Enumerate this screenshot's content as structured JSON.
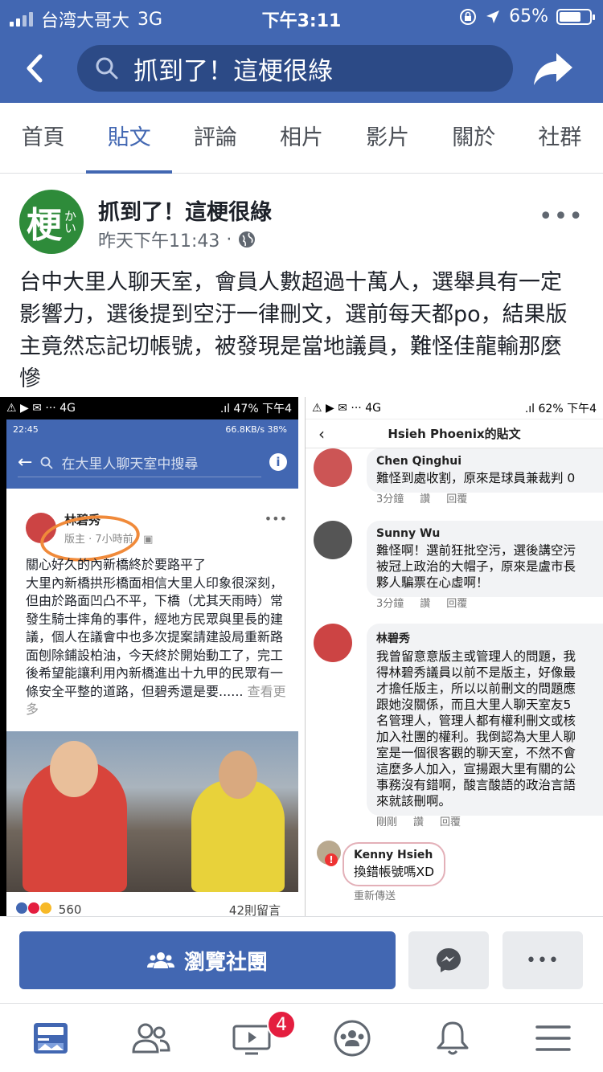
{
  "status_bar": {
    "carrier": "台湾大哥大",
    "network": "3G",
    "time": "下午3:11",
    "battery": "65%"
  },
  "nav": {
    "search_query": "抓到了！這梗很綠"
  },
  "tabs": [
    {
      "label": "首頁",
      "active": false
    },
    {
      "label": "貼文",
      "active": true
    },
    {
      "label": "評論",
      "active": false
    },
    {
      "label": "相片",
      "active": false
    },
    {
      "label": "影片",
      "active": false
    },
    {
      "label": "關於",
      "active": false
    },
    {
      "label": "社群",
      "active": false
    }
  ],
  "post": {
    "avatar_char": "梗",
    "avatar_small": "かい",
    "page_name": "抓到了！這梗很綠",
    "timestamp": "昨天下午11:43",
    "separator": "·",
    "text": "台中大里人聊天室，會員人數超過十萬人，選舉具有一定影響力，選後提到空汙一律刪文，選前每天都po，結果版主竟然忘記切帳號，被發現是當地議員，難怪佳龍輸那麼慘"
  },
  "left_shot": {
    "status_left": "⚠ ▶ ✉ ··· 4G",
    "status_right": ".ıl 47% 下午4",
    "inner_time": "22:45",
    "inner_status": "66.8KB/s 38%",
    "search_placeholder": "在大里人聊天室中搜尋",
    "author": "林碧秀",
    "meta": "版主 · 7小時前 · ▣",
    "body": "關心好久的內新橋終於要路平了\n大里內新橋拱形橋面相信大里人印象很深刻，但由於路面凹凸不平，下橋（尤其天雨時）常發生騎士摔角的事件，經地方民眾與里長的建議，個人在議會中也多次提案請建設局重新路面刨除鋪設柏油，今天終於開始動工了，完工後希望能讓利用內新橋進出十九甲的民眾有一條安全平整的道路，但碧秀還是要......",
    "see_more": "查看更多",
    "reactions": "560",
    "comments": "42則留言"
  },
  "right_shot": {
    "status_left": "⚠ ▶ ✉ ··· 4G",
    "status_right": ".ıl 62% 下午4",
    "title": "Hsieh Phoenix的貼文",
    "comments": [
      {
        "name": "Chen Qinghui",
        "text": "難怪到處收割，原來是球員兼裁判 0",
        "time": "3分鐘",
        "like": "讚",
        "reply": "回覆"
      },
      {
        "name": "Sunny Wu",
        "text": "難怪啊！選前狂批空污，選後講空污\n被冠上政治的大帽子，原來是盧市長\n夥人騙票在心虛啊！",
        "time": "3分鐘",
        "like": "讚",
        "reply": "回覆"
      },
      {
        "name": "林碧秀",
        "text": "我曾留意意版主或管理人的問題，我\n得林碧秀議員以前不是版主，好像最\n才擔任版主，所以以前刪文的問題應\n跟她沒關係，而且大里人聊天室友5\n名管理人，管理人都有權利刪文或核\n加入社團的權利。我倒認為大里人聊\n室是一個很客觀的聊天室，不然不會\n這麼多人加入，宣揚跟大里有關的公\n事務沒有錯啊，酸言酸語的政治言語\n來就該刪啊。",
        "time": "剛剛",
        "like": "讚",
        "reply": "回覆"
      }
    ],
    "kenny_name": "Kenny Hsieh",
    "kenny_text": "換錯帳號嗎XD",
    "resend": "重新傳送"
  },
  "actions": {
    "browse_label": "瀏覽社團"
  },
  "bottom_nav": {
    "video_badge": "4"
  },
  "colors": {
    "brand": "#4267b2",
    "badge": "#e41e3f"
  }
}
